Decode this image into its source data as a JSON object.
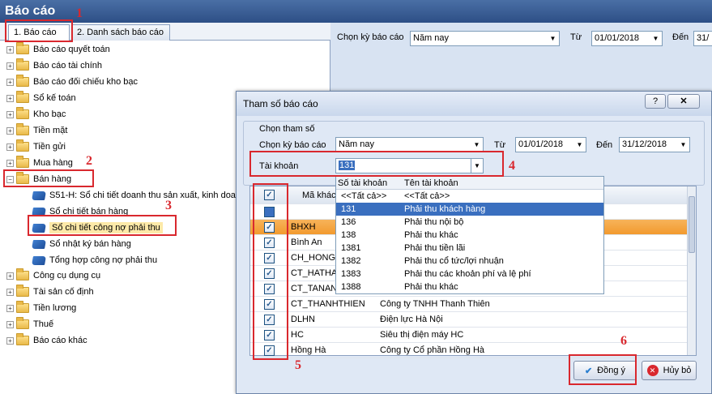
{
  "window": {
    "title": "Báo cáo"
  },
  "tabs": [
    {
      "label": "1. Báo cáo"
    },
    {
      "label": "2. Danh sách báo cáo"
    }
  ],
  "tree": {
    "folders_top": [
      "Báo cáo quyết toán",
      "Báo cáo tài chính",
      "Báo cáo đối chiếu kho bạc",
      "Sổ kế toán",
      "Kho bạc",
      "Tiền mặt",
      "Tiền gửi",
      "Mua hàng",
      "Bán hàng"
    ],
    "ban_hang_children": [
      "S51-H: Sổ chi tiết doanh thu sản xuất, kinh doa",
      "Sổ chi tiết bán hàng",
      "Sổ chi tiết công nợ phải thu",
      "Sổ nhật ký bán hàng",
      "Tổng hợp công nợ phải thu"
    ],
    "folders_bottom": [
      "Công cụ dụng cụ",
      "Tài sản cố định",
      "Tiền lương",
      "Thuế",
      "Báo cáo khác"
    ]
  },
  "filter": {
    "period_label": "Chọn kỳ báo cáo",
    "period_value": "Năm nay",
    "from_label": "Từ",
    "from_value": "01/01/2018",
    "to_label": "Đến",
    "to_value": "31/"
  },
  "dialog": {
    "title": "Tham số báo cáo",
    "help_btn": "?",
    "group_label": "Chọn tham số",
    "period_label": "Chọn kỳ báo cáo",
    "period_value": "Năm nay",
    "from_label": "Từ",
    "from_value": "01/01/2018",
    "to_label": "Đến",
    "to_value": "31/12/2018",
    "account_label": "Tài khoản",
    "account_value": "131",
    "dropdown": {
      "header_col1": "Số tài khoản",
      "header_col2": "Tên tài khoản",
      "items": [
        {
          "code": "<<Tất cả>>",
          "name": "<<Tất cả>>"
        },
        {
          "code": "131",
          "name": "Phải thu khách hàng"
        },
        {
          "code": "136",
          "name": "Phải thu nội bộ"
        },
        {
          "code": "138",
          "name": "Phải thu khác"
        },
        {
          "code": "1381",
          "name": "Phải thu tiền lãi"
        },
        {
          "code": "1382",
          "name": "Phải thu cổ tức/lợi nhuận"
        },
        {
          "code": "1383",
          "name": "Phải thu các khoản phí và lệ phí"
        },
        {
          "code": "1388",
          "name": "Phải thu khác"
        }
      ]
    },
    "grid": {
      "col_code": "Mã khác",
      "rows": [
        {
          "code": "",
          "name": ""
        },
        {
          "code": "BHXH",
          "name": ""
        },
        {
          "code": "Bình An",
          "name": ""
        },
        {
          "code": "CH_HONG",
          "name": ""
        },
        {
          "code": "CT_HATHA",
          "name": ""
        },
        {
          "code": "CT_TANAN",
          "name": ""
        },
        {
          "code": "CT_THANHTHIEN",
          "name": "Công ty TNHH Thanh Thiên"
        },
        {
          "code": "DLHN",
          "name": "Điện lực Hà Nội"
        },
        {
          "code": "HC",
          "name": "Siêu thị điện máy HC"
        },
        {
          "code": "Hồng Hà",
          "name": "Công ty Cổ phần Hồng Hà"
        }
      ]
    },
    "ok_label": "Đồng ý",
    "cancel_label": "Hủy bỏ"
  },
  "annotations": [
    "1",
    "2",
    "3",
    "4",
    "5",
    "6"
  ]
}
